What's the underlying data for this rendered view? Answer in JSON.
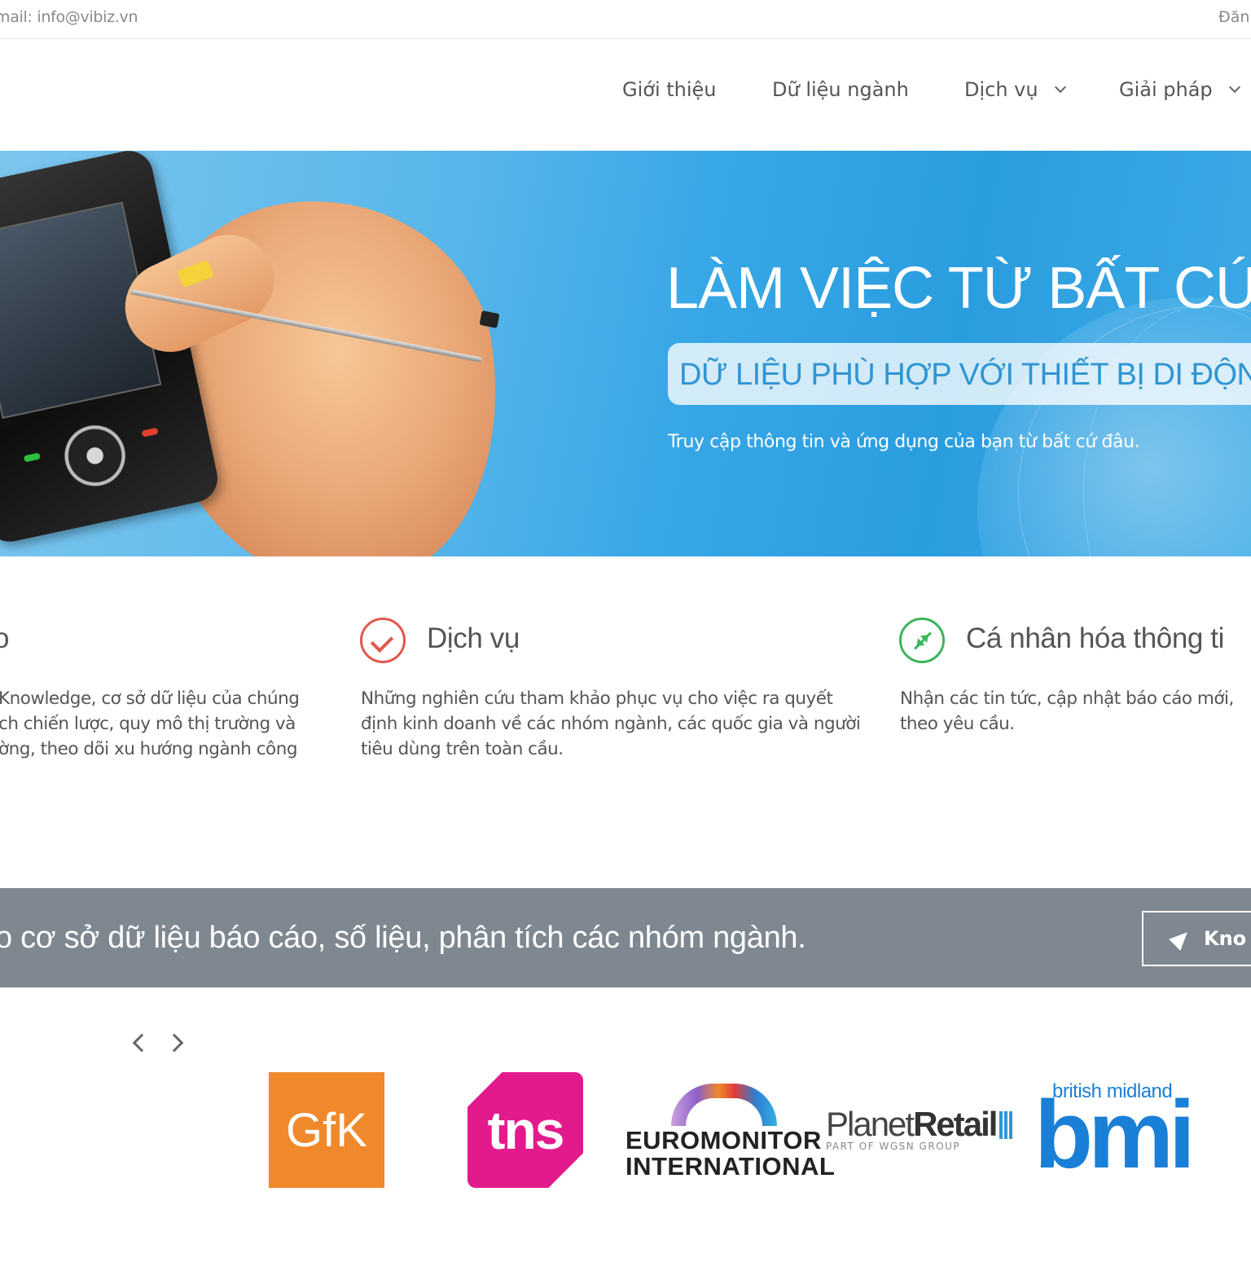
{
  "topbar": {
    "email": "mail: info@vibiz.vn",
    "login": "Đăn"
  },
  "nav": {
    "items": [
      {
        "label": "Giới thiệu",
        "has_dropdown": false
      },
      {
        "label": "Dữ liệu ngành",
        "has_dropdown": false
      },
      {
        "label": "Dịch vụ",
        "has_dropdown": true
      },
      {
        "label": "Giải pháp",
        "has_dropdown": true
      }
    ]
  },
  "hero": {
    "title": "LÀM VIỆC TỪ BẤT CỨ",
    "subtitle": "DỮ LIỆU PHÙ HỢP VỚI THIẾT BỊ DI ĐỘNG",
    "description": "Truy cập thông tin và ứng dụng của bạn từ bất cứ đâu."
  },
  "features": [
    {
      "title": "o",
      "icon": "none",
      "lines": [
        "Knowledge, cơ sở dữ liệu của chúng",
        "ch chiến lược, quy mô thị trường và",
        "ờng, theo dõi xu hướng ngành công"
      ]
    },
    {
      "title": "Dịch vụ",
      "icon": "check-circle-icon",
      "lines": [
        "Những nghiên cứu tham khảo phục vụ cho việc ra quyết",
        "định kinh doanh về các nhóm ngành, các quốc gia và người",
        "tiêu dùng trên toàn cầu."
      ]
    },
    {
      "title": "Cá nhân hóa thông ti",
      "icon": "compress-icon",
      "lines": [
        "Nhận các tin tức, cập nhật báo cáo mới,",
        "theo yêu cầu."
      ]
    }
  ],
  "banner": {
    "text": "o cơ sở dữ liệu báo cáo, số liệu, phân tích các nhóm ngành.",
    "button_label": "Kno",
    "button_icon": "rocket-icon"
  },
  "partners": {
    "gfk": "GfK",
    "tns": "tns",
    "euromonitor_line1": "EUROMONITOR",
    "euromonitor_line2": "INTERNATIONAL",
    "planet_retail_a": "Planet",
    "planet_retail_b": "Retail",
    "planet_retail_tag": "PART OF WGSN GROUP",
    "bmi_top": "british midland",
    "bmi_main": "bmi"
  },
  "colors": {
    "hero_blue": "#37a7e6",
    "banner_gray": "#7f8891",
    "check_red": "#e2574c",
    "compress_green": "#3ab55a",
    "gfk_orange": "#f0892b",
    "tns_magenta": "#e31a8c",
    "bmi_blue": "#1a7fd6"
  }
}
